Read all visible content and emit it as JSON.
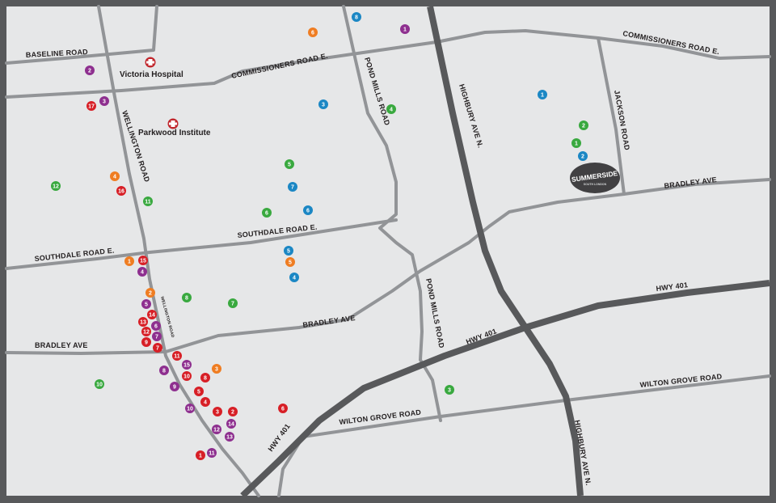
{
  "colors": {
    "frame": "#58595b",
    "land": "#e6e7e8",
    "road": "#929497",
    "highway": "#58595b",
    "hospital": "#c1272d",
    "summerside_badge": "#414042",
    "marker_red": "#d71f26",
    "marker_purple": "#8e2f8f",
    "marker_orange": "#ef7d22",
    "marker_green": "#39a93f",
    "marker_blue": "#1b87c4"
  },
  "roads": {
    "baseline": "BASELINE ROAD",
    "commissioners_w": "COMMISSIONERS ROAD E.",
    "commissioners_e": "COMMISSIONERS ROAD E.",
    "wellington": "WELLINGTON ROAD",
    "wellington_small": "WELLINGTON ROAD",
    "pond_mills_n": "POND MILLS ROAD",
    "pond_mills_s": "POND MILLS ROAD",
    "highbury_n": "HIGHBURY AVE N.",
    "highbury_s": "HIGHBURY AVE N.",
    "jackson": "JACKSON ROAD",
    "bradley_e": "BRADLEY AVE",
    "bradley_mid": "BRADLEY AVE",
    "bradley_w": "BRADLEY AVE",
    "southdale_w": "SOUTHDALE ROAD E.",
    "southdale_mid": "SOUTHDALE ROAD E.",
    "hwy401_e": "HWY 401",
    "hwy401_mid": "HWY 401",
    "hwy401_sw": "HWY 401",
    "wilton_e": "WILTON GROVE ROAD",
    "wilton_w": "WILTON GROVE ROAD"
  },
  "poi": {
    "victoria": "Victoria Hospital",
    "parkwood": "Parkwood Institute",
    "summerside_title": "SUMMERSIDE",
    "summerside_sub": "SOUTH LONDON"
  },
  "markers": [
    {
      "c": "red",
      "n": "17"
    },
    {
      "c": "red",
      "n": "16"
    },
    {
      "c": "red",
      "n": "15"
    },
    {
      "c": "red",
      "n": "14"
    },
    {
      "c": "red",
      "n": "13"
    },
    {
      "c": "red",
      "n": "12"
    },
    {
      "c": "red",
      "n": "9"
    },
    {
      "c": "red",
      "n": "7"
    },
    {
      "c": "red",
      "n": "11"
    },
    {
      "c": "red",
      "n": "10"
    },
    {
      "c": "red",
      "n": "8"
    },
    {
      "c": "red",
      "n": "5"
    },
    {
      "c": "red",
      "n": "4"
    },
    {
      "c": "red",
      "n": "3"
    },
    {
      "c": "red",
      "n": "2"
    },
    {
      "c": "red",
      "n": "1"
    },
    {
      "c": "red",
      "n": "6"
    },
    {
      "c": "purple",
      "n": "1"
    },
    {
      "c": "purple",
      "n": "2"
    },
    {
      "c": "purple",
      "n": "3"
    },
    {
      "c": "purple",
      "n": "4"
    },
    {
      "c": "purple",
      "n": "5"
    },
    {
      "c": "purple",
      "n": "6"
    },
    {
      "c": "purple",
      "n": "7"
    },
    {
      "c": "purple",
      "n": "15"
    },
    {
      "c": "purple",
      "n": "8"
    },
    {
      "c": "purple",
      "n": "9"
    },
    {
      "c": "purple",
      "n": "10"
    },
    {
      "c": "purple",
      "n": "14"
    },
    {
      "c": "purple",
      "n": "12"
    },
    {
      "c": "purple",
      "n": "13"
    },
    {
      "c": "purple",
      "n": "11"
    },
    {
      "c": "orange",
      "n": "6"
    },
    {
      "c": "orange",
      "n": "4"
    },
    {
      "c": "orange",
      "n": "1"
    },
    {
      "c": "orange",
      "n": "2"
    },
    {
      "c": "orange",
      "n": "5"
    },
    {
      "c": "orange",
      "n": "3"
    },
    {
      "c": "green",
      "n": "4"
    },
    {
      "c": "green",
      "n": "2"
    },
    {
      "c": "green",
      "n": "1"
    },
    {
      "c": "green",
      "n": "5"
    },
    {
      "c": "green",
      "n": "12"
    },
    {
      "c": "green",
      "n": "11"
    },
    {
      "c": "green",
      "n": "6"
    },
    {
      "c": "green",
      "n": "8"
    },
    {
      "c": "green",
      "n": "7"
    },
    {
      "c": "green",
      "n": "10"
    },
    {
      "c": "green",
      "n": "3"
    },
    {
      "c": "blue",
      "n": "8"
    },
    {
      "c": "blue",
      "n": "3"
    },
    {
      "c": "blue",
      "n": "1"
    },
    {
      "c": "blue",
      "n": "2"
    },
    {
      "c": "blue",
      "n": "7"
    },
    {
      "c": "blue",
      "n": "6"
    },
    {
      "c": "blue",
      "n": "5"
    },
    {
      "c": "blue",
      "n": "4"
    }
  ]
}
